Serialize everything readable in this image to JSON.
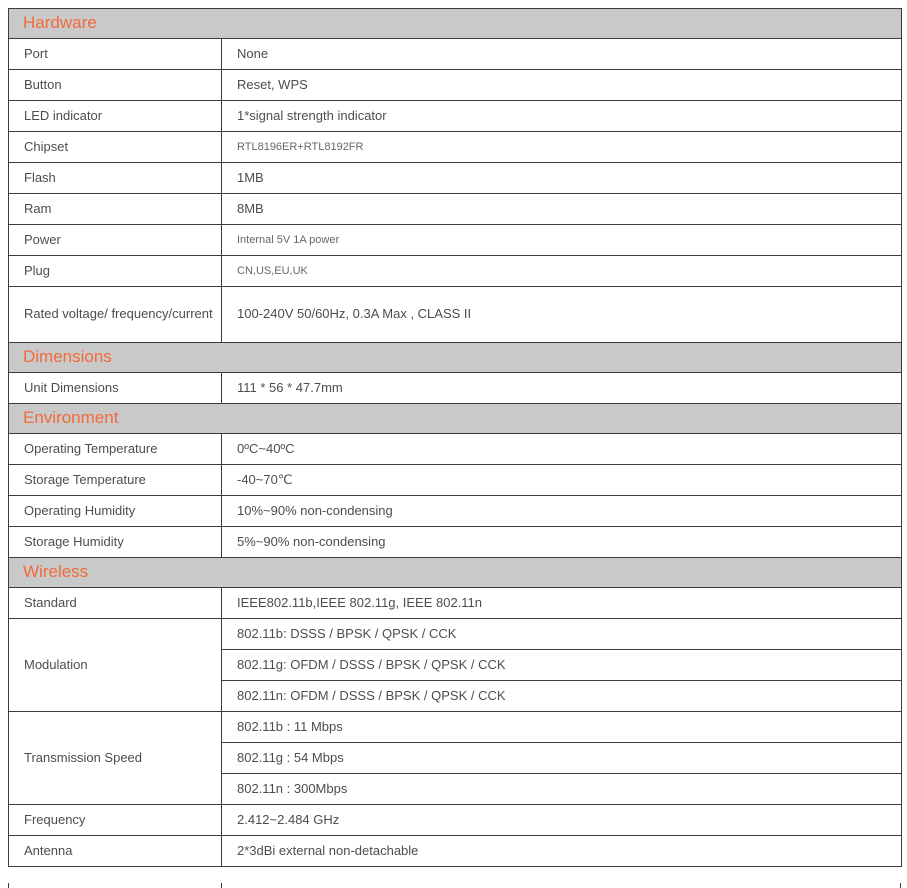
{
  "sections": [
    {
      "title": "Hardware",
      "rows": [
        {
          "label": "Port",
          "value": "None"
        },
        {
          "label": "Button",
          "value": "Reset, WPS"
        },
        {
          "label": "LED indicator",
          "value": "1*signal strength indicator"
        },
        {
          "label": "Chipset",
          "value": "RTL8196ER+RTL8192FR"
        },
        {
          "label": "Flash",
          "value": "1MB"
        },
        {
          "label": "Ram",
          "value": "8MB"
        },
        {
          "label": "Power",
          "value": "Internal 5V 1A power"
        },
        {
          "label": "Plug",
          "value": "CN,US,EU,UK"
        },
        {
          "label": "Rated voltage/ frequency/current",
          "value": "100-240V 50/60Hz, 0.3A Max , CLASS II"
        }
      ]
    },
    {
      "title": "Dimensions",
      "rows": [
        {
          "label": "Unit Dimensions",
          "value": "111 * 56 * 47.7mm"
        }
      ]
    },
    {
      "title": "Environment",
      "rows": [
        {
          "label": "Operating Temperature",
          "value": "0ºC~40ºC"
        },
        {
          "label": "Storage Temperature",
          "value": "-40~70℃"
        },
        {
          "label": "Operating Humidity",
          "value": "10%~90% non-condensing"
        },
        {
          "label": "Storage Humidity",
          "value": "5%~90% non-condensing"
        }
      ]
    },
    {
      "title": "Wireless",
      "rows": [
        {
          "label": "Standard",
          "value": "IEEE802.11b,IEEE 802.11g, IEEE 802.11n"
        },
        {
          "label": "Modulation",
          "values": [
            "802.11b: DSSS / BPSK / QPSK / CCK",
            "802.11g: OFDM / DSSS / BPSK / QPSK / CCK",
            "802.11n: OFDM / DSSS / BPSK / QPSK / CCK"
          ]
        },
        {
          "label": "Transmission Speed",
          "values": [
            "802.11b : 11 Mbps",
            "802.11g : 54 Mbps",
            "802.11n : 300Mbps"
          ]
        },
        {
          "label": "Frequency",
          "value": "2.412~2.484 GHz"
        },
        {
          "label": "Antenna",
          "value": "2*3dBi external non-detachable"
        }
      ]
    }
  ]
}
